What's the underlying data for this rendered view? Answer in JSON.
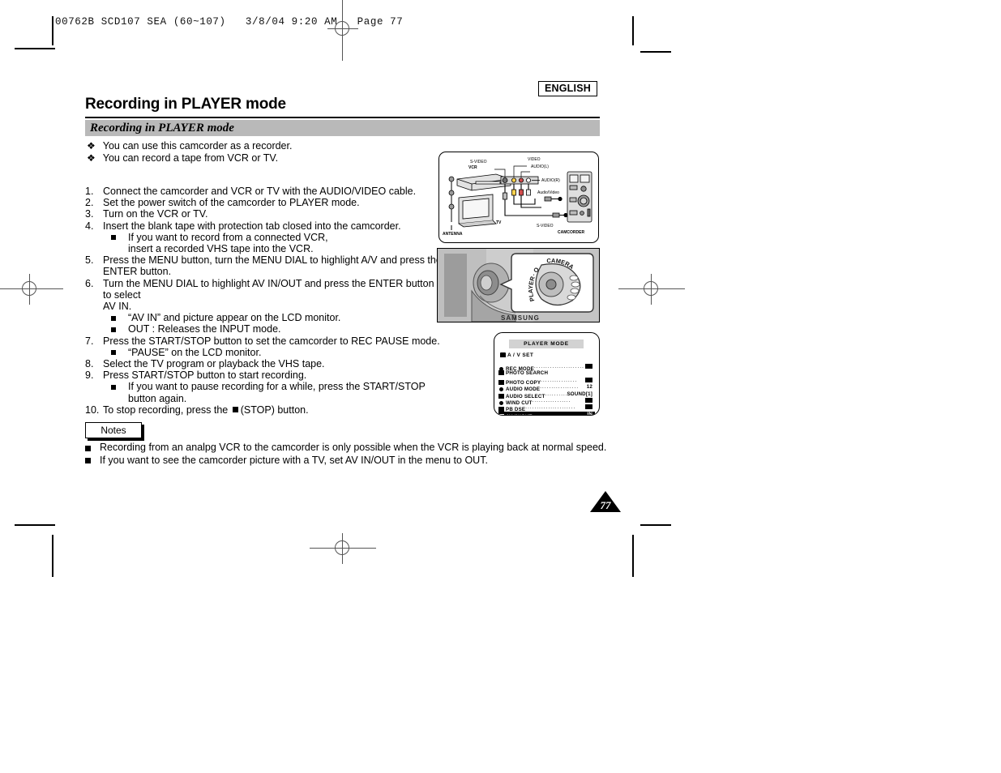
{
  "file_header": "00762B SCD107 SEA (60~107)   3/8/04 9:20 AM   Page 77",
  "language_badge": "ENGLISH",
  "page_title": "Recording in PLAYER mode",
  "section_heading": "Recording in PLAYER mode",
  "intro_bullets": [
    "You can use this camcorder as a recorder.",
    "You can record a tape from VCR or TV."
  ],
  "steps": [
    {
      "num": "1.",
      "text": "Connect the camcorder and VCR or TV with the AUDIO/VIDEO cable.",
      "subs": []
    },
    {
      "num": "2.",
      "text": "Set the power switch of the camcorder to PLAYER mode.",
      "subs": []
    },
    {
      "num": "3.",
      "text": "Turn on the VCR or TV.",
      "subs": []
    },
    {
      "num": "4.",
      "text": "Insert the blank tape with protection tab closed into the camcorder.",
      "subs": [
        "If you want to record from a connected VCR,\ninsert a recorded VHS tape into the VCR."
      ]
    },
    {
      "num": "5.",
      "text": "Press the MENU button, turn the MENU DIAL to highlight A/V and press the\nENTER button.",
      "subs": []
    },
    {
      "num": "6.",
      "text": "Turn the MENU DIAL to highlight AV IN/OUT and press the ENTER button to select\nAV IN.",
      "subs": [
        "“AV IN” and picture appear on the LCD monitor.",
        "OUT : Releases the INPUT mode."
      ]
    },
    {
      "num": "7.",
      "text": "Press the START/STOP button to set the camcorder to REC PAUSE mode.",
      "subs": [
        "“PAUSE” on the LCD monitor."
      ]
    },
    {
      "num": "8.",
      "text": "Select the TV program or playback the VHS tape.",
      "subs": []
    },
    {
      "num": "9.",
      "text": "Press START/STOP button to start recording.",
      "subs": [
        "If you want to pause recording for a while, press the START/STOP button again."
      ]
    },
    {
      "num": "10.",
      "text": "To stop recording, press the ■ (STOP) button.",
      "subs": []
    }
  ],
  "step10_before": "To stop recording, press the ",
  "step10_after": "(STOP) button.",
  "notes_label": "Notes",
  "notes": [
    "Recording from an analpg VCR to the camcorder is only possible when the VCR is playing back at normal speed.",
    "If you want to see the camcorder picture with a TV, set AV IN/OUT in the menu to OUT."
  ],
  "page_number": "77",
  "figures": {
    "connection_diagram": {
      "name": "camcorder-to-vcr-tv-connection-diagram",
      "labels": {
        "vcr": "VCR",
        "tv": "TV",
        "antenna": "ANTENNA",
        "camcorder": "CAMCORDER",
        "s_video_top": "S-VIDEO",
        "video": "VIDEO",
        "audio_l": "AUDIO(L)",
        "audio_r": "AUDIO(R)",
        "audio_video": "Audio/Video",
        "s_video_bottom": "S-VIDEO"
      }
    },
    "camcorder_photo": {
      "name": "camcorder-power-switch-photo",
      "callout_labels": [
        "PLAYER",
        "OFF",
        "CAMERA"
      ],
      "brand": "SAMSUNG"
    },
    "osd_menu": {
      "name": "player-mode-osd-menu",
      "title": "PLAYER MODE",
      "group": "A / V SET",
      "rows": [
        {
          "label": "REC MODE",
          "value": "",
          "value_type": "swatch",
          "icon": "round",
          "selected": false,
          "dots": 22
        },
        {
          "label": "PHOTO SEARCH",
          "value": "",
          "value_type": "none",
          "icon": "tape",
          "selected": false,
          "dots": 0
        },
        {
          "label": "PHOTO COPY",
          "value": "",
          "value_type": "swatch",
          "icon": "tape",
          "selected": false,
          "dots": 16
        },
        {
          "label": "AUDIO MODE",
          "value": "12",
          "value_type": "text",
          "icon": "round",
          "selected": false,
          "dots": 17
        },
        {
          "label": "AUDIO SELECT",
          "value": "SOUND[1]",
          "value_type": "text",
          "icon": "tape",
          "selected": false,
          "dots": 14
        },
        {
          "label": "WIND CUT",
          "value": "",
          "value_type": "swatch",
          "icon": "round",
          "selected": false,
          "dots": 17
        },
        {
          "label": "PB DSE",
          "value": "",
          "value_type": "swatch",
          "icon": "tape",
          "selected": false,
          "dots": 22
        },
        {
          "label": "AV IN/OUT",
          "value": "IN",
          "value_type": "text",
          "icon": "tape",
          "selected": true,
          "dots": 21
        }
      ]
    }
  }
}
